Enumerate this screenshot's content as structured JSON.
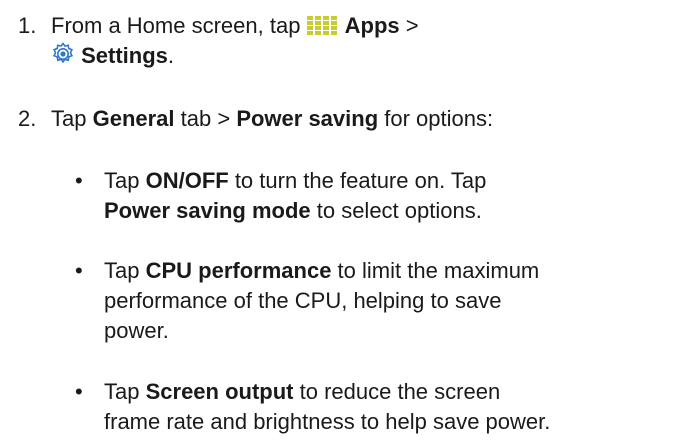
{
  "steps": [
    {
      "number": "1.",
      "line1_pre": "From a Home screen, tap ",
      "apps_icon": "apps-grid-icon",
      "apps_label": "Apps",
      "line1_post": " >",
      "settings_icon": "settings-gear-icon",
      "settings_label": "Settings",
      "line2_post": "."
    },
    {
      "number": "2.",
      "pre": "Tap ",
      "general": "General",
      "mid1": " tab > ",
      "power_saving": "Power saving",
      "post": " for options:"
    }
  ],
  "bullets": [
    {
      "l1_pre": "Tap ",
      "l1_bold": "ON/OFF",
      "l1_post": " to turn the feature on. Tap",
      "l2_bold": "Power saving mode",
      "l2_post": " to select options."
    },
    {
      "l1_pre": "Tap ",
      "l1_bold": "CPU performance",
      "l1_post": " to limit the maximum",
      "l2": "performance of the CPU, helping to save",
      "l3": "power."
    },
    {
      "l1_pre": "Tap ",
      "l1_bold": "Screen output",
      "l1_post": " to reduce the screen",
      "l2": "frame rate and brightness to help save power."
    }
  ],
  "bullet_char": "•",
  "colors": {
    "text": "#1a1a1a",
    "apps_icon": "#c8cc2e",
    "settings_icon": "#2f77c8"
  }
}
